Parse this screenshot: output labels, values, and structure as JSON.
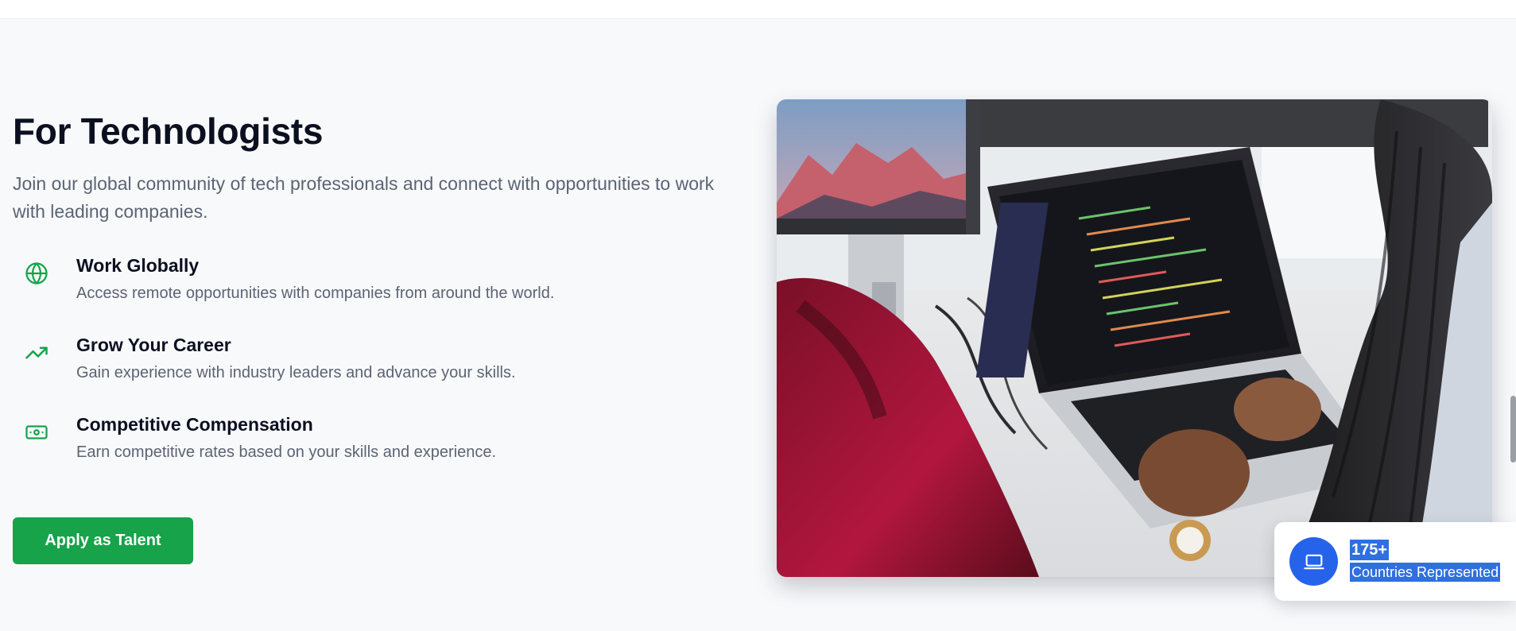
{
  "section": {
    "title": "For Technologists",
    "intro": "Join our global community of tech professionals and connect with opportunities to work with leading companies."
  },
  "features": [
    {
      "icon": "globe-icon",
      "title": "Work Globally",
      "description": "Access remote opportunities with companies from around the world."
    },
    {
      "icon": "trending-up-icon",
      "title": "Grow Your Career",
      "description": "Gain experience with industry leaders and advance your skills."
    },
    {
      "icon": "banknote-icon",
      "title": "Competitive Compensation",
      "description": "Earn competitive rates based on your skills and experience."
    }
  ],
  "cta": {
    "label": "Apply as Talent"
  },
  "stat": {
    "icon": "laptop-icon",
    "value": "175+",
    "label": "Countries Represented"
  },
  "colors": {
    "accent_green": "#16a34a",
    "accent_blue": "#2563eb",
    "selection": "#2f6fe0",
    "title": "#0b1020",
    "muted": "#5b6473"
  }
}
